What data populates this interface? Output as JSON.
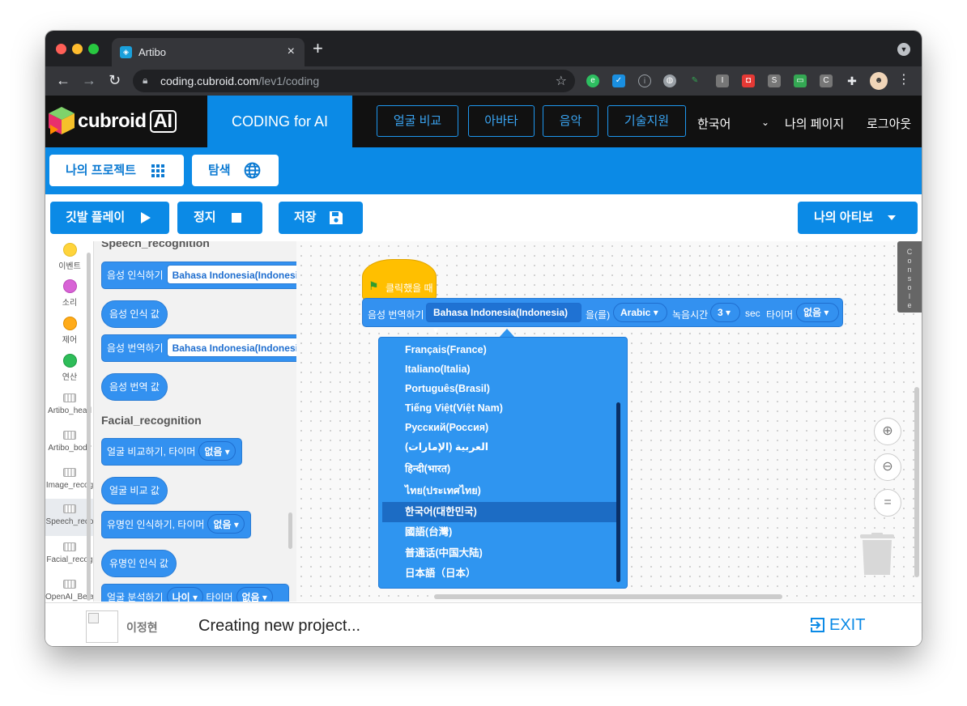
{
  "browser": {
    "tab_title": "Artibo",
    "tab_close": "×",
    "new_tab": "+",
    "url_host": "coding.cubroid.com",
    "url_path": "/lev1/coding"
  },
  "header": {
    "logo_text": "cubroid",
    "logo_ai": "AI",
    "coding_tab": "CODING for AI",
    "buttons": [
      "얼굴 비교",
      "아바타",
      "음악",
      "기술지원"
    ],
    "language": "한국어",
    "my_page": "나의 페이지",
    "logout": "로그아웃"
  },
  "toolbar1": {
    "my_projects": "나의 프로젝트",
    "explore": "탐색"
  },
  "toolbar2": {
    "play": "깃발 플레이",
    "stop": "정지",
    "save": "저장",
    "device": "나의 아티보"
  },
  "categories": [
    {
      "label": "이벤트",
      "color": "#ffd43b"
    },
    {
      "label": "소리",
      "color": "#d863d6"
    },
    {
      "label": "제어",
      "color": "#ffab19"
    },
    {
      "label": "연산",
      "color": "#2ebd59"
    },
    {
      "label": "Artibo_head"
    },
    {
      "label": "Artibo_body"
    },
    {
      "label": "Image_recog"
    },
    {
      "label": "Speech_reco"
    },
    {
      "label": "Facial_recog"
    },
    {
      "label": "OpenAI_Beta"
    }
  ],
  "palette": {
    "speech_title": "Speech_recognition",
    "speech_recognize": "음성 인식하기",
    "speech_lang": "Bahasa Indonesia(Indonesia)",
    "speech_value": "음성 인식 값",
    "speech_translate": "음성 번역하기",
    "translate_value": "음성 번역 값",
    "facial_title": "Facial_recognition",
    "face_compare": "얼굴 비교하기, 타이머",
    "none": "없음",
    "face_compare_value": "얼굴 비교 값",
    "celeb": "유명인 인식하기, 타이머",
    "celeb_value": "유명인 인식 값",
    "face_analysis": "얼굴 분석하기",
    "age": "나이",
    "timer": "타이머"
  },
  "workspace": {
    "hat_label": "클릭했을 때",
    "block_label": "음성 번역하기",
    "src_lang": "Bahasa Indonesia(Indonesia)",
    "particle": "을(를)",
    "target_lang": "Arabic",
    "record_label": "녹음시간",
    "record_value": "3",
    "sec": "sec",
    "timer_label": "타이머",
    "timer_value": "없음",
    "console": "Console",
    "zoom_reset": "="
  },
  "dropdown": {
    "items": [
      "Français(France)",
      "Italiano(Italia)",
      "Português(Brasil)",
      "Tiếng Việt(Việt Nam)",
      "Русский(Россия)",
      "العربية (الإمارات)",
      "हिन्दी(भारत)",
      "ไทย(ประเทศไทย)",
      "한국어(대한민국)",
      "國語(台灣)",
      "普通话(中国大陆)",
      "日本語（日本）"
    ],
    "selected_index": 8
  },
  "footer": {
    "username": "이정현",
    "status": "Creating new project...",
    "exit": "EXIT"
  },
  "colors": {
    "brand": "#0b8ae6",
    "block": "#3391f0",
    "hat": "#ffbf00",
    "header": "#111111"
  }
}
